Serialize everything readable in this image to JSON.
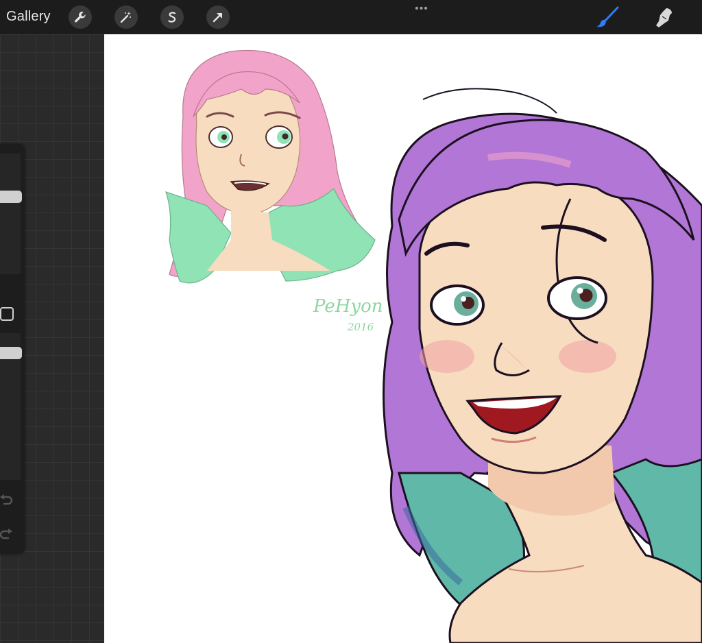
{
  "topbar": {
    "gallery_label": "Gallery",
    "tools": [
      {
        "name": "wrench-icon"
      },
      {
        "name": "magic-wand-icon"
      },
      {
        "name": "selection-s-icon"
      },
      {
        "name": "arrow-transform-icon"
      }
    ],
    "more_label": "•••",
    "right_tools": [
      {
        "name": "brush-icon",
        "color": "#2e7cf6"
      },
      {
        "name": "smudge-icon",
        "color": "#d8d8d8"
      }
    ]
  },
  "sidebar": {
    "icons": [
      "undo-icon",
      "redo-icon"
    ]
  },
  "artwork": {
    "signature_text": "PeHyon",
    "signature_year": "2016"
  },
  "colors": {
    "accent": "#2e7cf6",
    "topbar": "#1c1c1c",
    "canvas": "#ffffff",
    "hair_pink": "#f2a3c9",
    "hair_mint": "#8fe3b4",
    "hair_purple": "#b277d6",
    "hair_teal": "#5fb8a8",
    "skin": "#f7dcc0"
  }
}
